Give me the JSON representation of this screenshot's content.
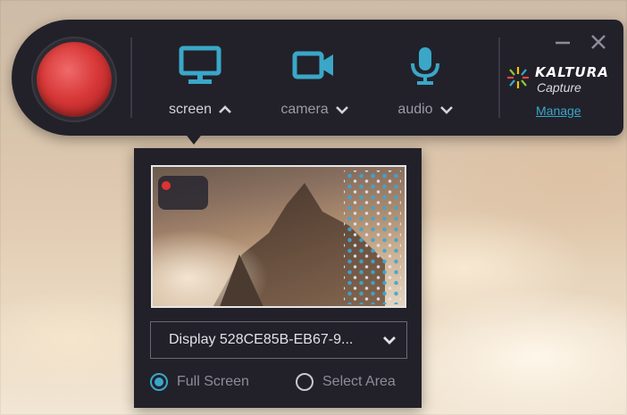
{
  "toolbar": {
    "record_label": "",
    "sources": [
      {
        "label": "screen",
        "icon": "monitor-icon",
        "state": "expanded"
      },
      {
        "label": "camera",
        "icon": "video-camera-icon",
        "state": "collapsed"
      },
      {
        "label": "audio",
        "icon": "microphone-icon",
        "state": "collapsed"
      }
    ],
    "window_controls": {
      "minimize": "—",
      "close": "✕"
    },
    "brand": {
      "name": "KALTURA",
      "subtitle": "Capture"
    },
    "manage_label": "Manage"
  },
  "screen_panel": {
    "display_select": "Display 528CE85B-EB67-9...",
    "capture_modes": [
      {
        "label": "Full Screen",
        "selected": true
      },
      {
        "label": "Select Area",
        "selected": false
      }
    ]
  },
  "colors": {
    "accent": "#3aa7c8",
    "record": "#d83838",
    "toolbar_bg": "#22212a"
  }
}
